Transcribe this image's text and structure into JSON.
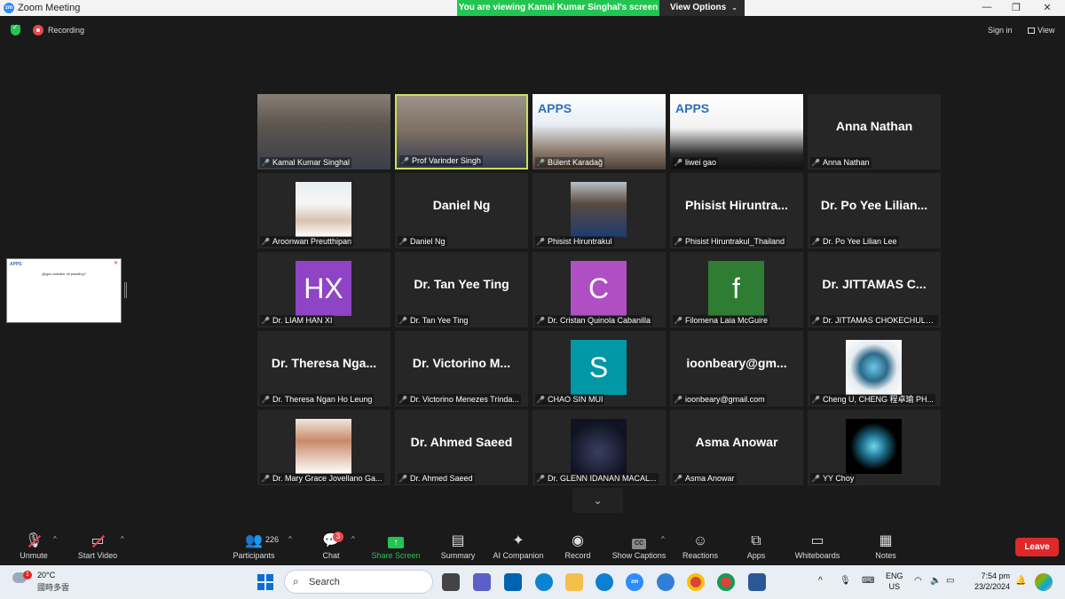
{
  "window": {
    "title": "Zoom Meeting",
    "app_icon": "zm",
    "viewing_banner": "You are viewing Kamal Kumar Singhal's screen",
    "view_options": "View Options"
  },
  "status": {
    "recording": "Recording",
    "sign_in": "Sign in",
    "view": "View"
  },
  "colors": {
    "accent_green": "#23c552",
    "leave_red": "#e02828",
    "active_speaker": "#c8e05a"
  },
  "participants": [
    {
      "label": "Kamal Kumar Singhal",
      "kind": "video"
    },
    {
      "label": "Prof Varinder Singh",
      "kind": "video",
      "active": true
    },
    {
      "label": "Bülent Karadağ",
      "kind": "video"
    },
    {
      "label": "liwei gao",
      "kind": "video"
    },
    {
      "label": "Anna Nathan",
      "big": "Anna Nathan",
      "kind": "name"
    },
    {
      "label": "Aroonwan Preutthipan",
      "kind": "photo"
    },
    {
      "label": "Daniel Ng",
      "big": "Daniel Ng",
      "kind": "name"
    },
    {
      "label": "Phisist Hiruntrakul",
      "kind": "photo"
    },
    {
      "label": "Phisist Hiruntrakul_Thailand",
      "big": "Phisist  Hiruntra...",
      "kind": "name"
    },
    {
      "label": "Dr. Po Yee Lilian Lee",
      "big": "Dr. Po Yee Lilian...",
      "kind": "name"
    },
    {
      "label": "Dr. LIAM HAN XI",
      "avatar": "HX",
      "color": "#8e44c4",
      "kind": "avatar"
    },
    {
      "label": "Dr. Tan Yee Ting",
      "big": "Dr. Tan Yee Ting",
      "kind": "name"
    },
    {
      "label": "Dr. Cristan Quinola Cabanilla",
      "avatar": "C",
      "color": "#b04ec4",
      "kind": "avatar"
    },
    {
      "label": "Filomena Laia McGuire",
      "avatar": "f",
      "color": "#2e7d32",
      "kind": "avatar"
    },
    {
      "label": "Dr. JITTAMAS CHOKECHULE...",
      "big": "Dr.  JITTAMAS  C...",
      "kind": "name"
    },
    {
      "label": "Dr. Theresa Ngan Ho Leung",
      "big": "Dr.  Theresa  Nga...",
      "kind": "name"
    },
    {
      "label": "Dr. Victorino Menezes Trinda...",
      "big": "Dr.  Victorino  M...",
      "kind": "name"
    },
    {
      "label": "CHAO SIN MUI",
      "avatar": "S",
      "color": "#0097a7",
      "kind": "avatar"
    },
    {
      "label": "ioonbeary@gmail.com",
      "big": "ioonbeary@gm...",
      "kind": "name"
    },
    {
      "label": "Cheng U, CHENG 程卓瑜 PH...",
      "kind": "photo"
    },
    {
      "label": "Dr. Mary Grace Jovellano Ga...",
      "kind": "photo"
    },
    {
      "label": "Dr. Ahmed Saeed",
      "big": "Dr. Ahmed Saeed",
      "kind": "name"
    },
    {
      "label": "Dr. GLENN IDANAN MACAL...",
      "kind": "photo"
    },
    {
      "label": "Asma Anowar",
      "big": "Asma Anowar",
      "kind": "name"
    },
    {
      "label": "YY Choy",
      "kind": "photo"
    }
  ],
  "shared_thumb": {
    "logo": "APPS",
    "question": "Дsgnu saleаlor idi pasaling?"
  },
  "toolbar": {
    "unmute": "Unmute",
    "start_video": "Start Video",
    "participants": "Participants",
    "participants_count": "226",
    "chat": "Chat",
    "chat_badge": "3",
    "share_screen": "Share Screen",
    "summary": "Summary",
    "ai_companion": "AI Companion",
    "record": "Record",
    "show_captions": "Show Captions",
    "cc": "CC",
    "reactions": "Reactions",
    "apps": "Apps",
    "whiteboards": "Whiteboards",
    "notes": "Notes",
    "leave": "Leave"
  },
  "taskbar": {
    "weather_badge": "1",
    "temperature": "20°C",
    "weather_desc": "國時多雲",
    "search": "Search",
    "lang_top": "ENG",
    "lang_bottom": "US",
    "time": "7:54 pm",
    "date": "23/2/2024",
    "zoom_icon": "zm"
  }
}
